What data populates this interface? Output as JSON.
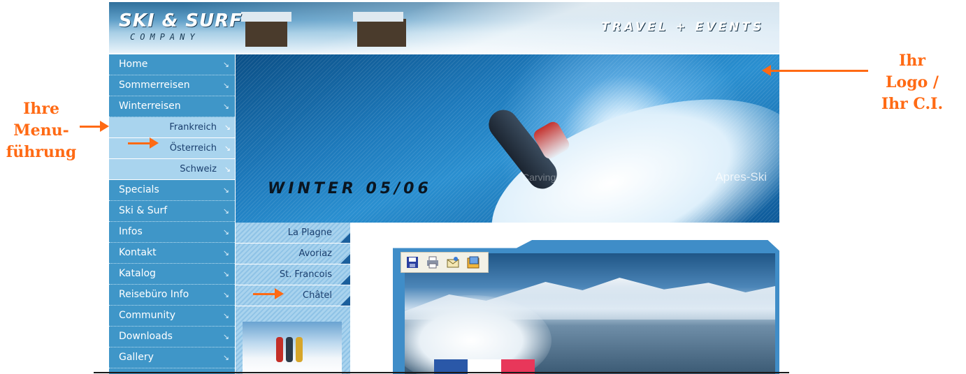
{
  "header": {
    "logo_title": "SKI & SURF",
    "logo_subtitle": "COMPANY",
    "tagline": "TRAVEL + EVENTS"
  },
  "sidebar": {
    "items": [
      {
        "label": "Home"
      },
      {
        "label": "Sommerreisen"
      },
      {
        "label": "Winterreisen"
      },
      {
        "label": "Frankreich"
      },
      {
        "label": "Österreich"
      },
      {
        "label": "Schweiz"
      },
      {
        "label": "Specials"
      },
      {
        "label": "Ski & Surf"
      },
      {
        "label": "Infos"
      },
      {
        "label": "Kontakt"
      },
      {
        "label": "Katalog"
      },
      {
        "label": "Reisebüro Info"
      },
      {
        "label": "Community"
      },
      {
        "label": "Downloads"
      },
      {
        "label": "Gallery"
      }
    ],
    "arrow_glyph": "↘"
  },
  "hero": {
    "title": "WINTER 05/06",
    "word_left": "Carving",
    "word_right": "Apres-Ski"
  },
  "subnav": {
    "items": [
      {
        "label": "La Plagne"
      },
      {
        "label": "Avoriaz"
      },
      {
        "label": "St. Francois"
      },
      {
        "label": "Châtel"
      }
    ]
  },
  "toolbar": {
    "icons": [
      "save-icon",
      "print-icon",
      "email-icon",
      "gallery-icon"
    ]
  },
  "annotations": {
    "left": {
      "line1": "Ihre",
      "line2": "Menu-",
      "line3": "führung"
    },
    "right": {
      "line1": "Ihr",
      "line2": "Logo /",
      "line3": "Ihr C.I."
    }
  },
  "colors": {
    "menu_bg": "#3f96c8",
    "submenu_bg": "#a9d4ee",
    "annotation": "#ff6a14",
    "flag": [
      "#2a58a8",
      "#ffffff",
      "#e8375a"
    ]
  }
}
